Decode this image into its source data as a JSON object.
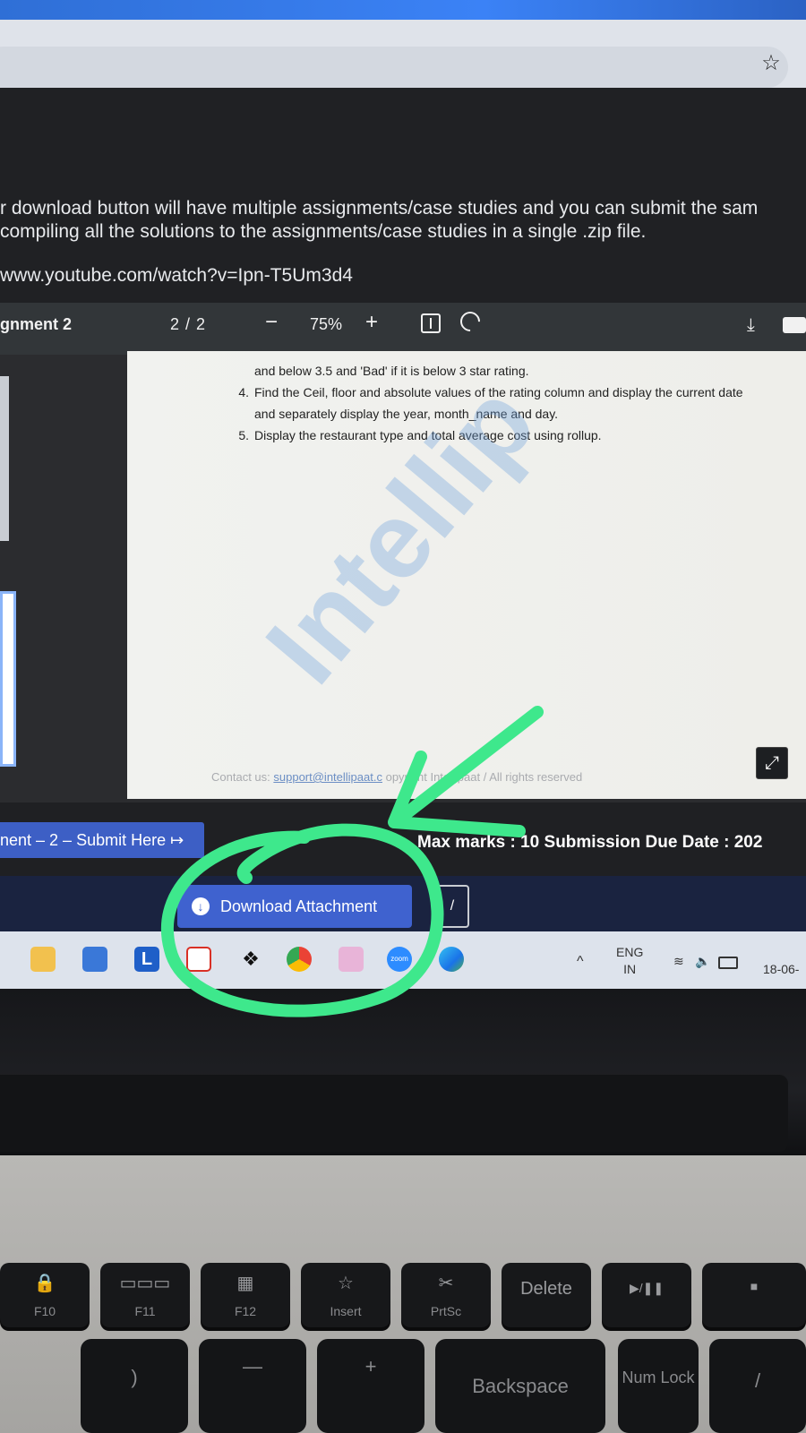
{
  "browser": {
    "bookmark_icon": "star-icon"
  },
  "page": {
    "desc_line1": "r download button will have multiple assignments/case studies and you can submit the sam",
    "desc_line2": "compiling all the solutions to the assignments/case studies in a single .zip file.",
    "link": "www.youtube.com/watch?v=Ipn-T5Um3d4"
  },
  "pdf": {
    "title": "gnment 2",
    "pages": "2 / 2",
    "zoom": "75%",
    "zoom_minus": "−",
    "zoom_plus": "+",
    "lines": [
      {
        "num": "",
        "text": "and below 3.5 and 'Bad' if it is below 3 star rating."
      },
      {
        "num": "4.",
        "text": "Find the Ceil, floor and absolute values of the rating column and display the current date"
      },
      {
        "num": "",
        "text": "and separately display the year, month_name and day."
      },
      {
        "num": "5.",
        "text": "Display the restaurant type and total average cost using rollup."
      }
    ],
    "watermark": "Intellip",
    "footer_prefix": "Contact us: ",
    "footer_link": "support@intellipaat.c",
    "footer_suffix": "    opyright Intellipaat / All rights reserved"
  },
  "assignment": {
    "submit_label": "nent – 2 – Submit Here",
    "submit_icon": "↦",
    "max_marks": "Max marks : 10  Submission Due Date : 202",
    "download_label": "Download Attachment",
    "edit_label": "/"
  },
  "taskbar": {
    "lang_top": "ENG",
    "lang_bottom": "IN",
    "chevron": "^",
    "clock": "18-06-",
    "l_app": "L",
    "zoom_app": "zoom"
  },
  "keyboard": {
    "keys": [
      "F10",
      "F11",
      "F12",
      "Insert",
      "PrtSc",
      "Delete",
      "▶/❚❚",
      "■"
    ],
    "bottom_keys": [
      ")",
      "—",
      "+",
      "Backspace",
      "Num Lock",
      "/"
    ]
  }
}
